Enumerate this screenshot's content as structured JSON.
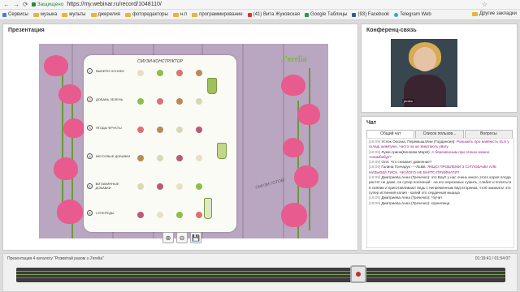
{
  "browser": {
    "back_icon": "arrow-left-icon",
    "forward_icon": "arrow-right-icon",
    "reload_icon": "reload-icon",
    "secure_label": "Защищено",
    "url": "https://my.webinar.ru/record/1048110/"
  },
  "bookmarks": {
    "items": [
      "Сервисы",
      "музыка",
      "мульты",
      "джерелия",
      "фоторедакторы",
      "н.п",
      "программирование",
      "(41) Вита Жуковская",
      "Google Таблицы",
      "(93) Facebook",
      "Telegram Web"
    ],
    "other": "Другие закладки"
  },
  "presentation": {
    "title": "Презентация",
    "brand": "J'erelia",
    "slide_title": "СМУЗИ-КОНСТРУКТОР",
    "steps": [
      "ВЫБЕРИ ОСНОВУ",
      "ДОБАВЬ ЗЕЛЕНЬ",
      "ЯГОДЫ ФРУКТЫ",
      "ВКУСОВЫЕ ДОБАВКИ",
      "ВИТАМИННЫЕ ДОБАВКИ",
      "СУПЕРЕДЫ"
    ],
    "step_nums": [
      "1",
      "2",
      "3",
      "4",
      "5",
      "6"
    ],
    "ready_text": "СМУЗИ ГОТОВ!",
    "zoom_in": "⊕",
    "zoom_out": "⊖",
    "save": "💾"
  },
  "conference": {
    "title": "Конференц-связь",
    "video_label": "jerelia"
  },
  "chat": {
    "title": "Чат",
    "tabs": [
      "Общий чат",
      "Список пользов...",
      "Вопросы"
    ],
    "messages": [
      {
        "time": "[18:09]",
        "author": "Устюк Оксана, Перемышляни (Гордансия):",
        "text": "Розкажіть про наявність SLS у складі шампуню, часто на це звертають увагу",
        "style": "pk"
      },
      {
        "time": "[18:09]",
        "author": "Лукач Ірина(Бачкова Марія):",
        "text": "А беременным при отеках можно тонимбибур?",
        "style": "pk"
      },
      {
        "time": "[18:09]",
        "author": "Оля:",
        "text": "Что снижает давление?",
        "style": "tx"
      },
      {
        "time": "[18:09]",
        "author": "Галина Гончарук ----Львів:",
        "text": "ЯКЩО ПРОБЛЕМИ З СУГЛОБАМИ АЛЕ НИЗЬКИЙ ТИСК. ЧИ ЙОГО НЕ ВАРТО ПРИЙМАТИ?",
        "style": "pk"
      },
      {
        "time": "[18:09]",
        "author": "Дмитриева Анна (Гречечко):",
        "text": "это Вау!! у нас очень много этого корня плода растет не даже, он супер полезный - на его нерезаных сушить, слабит и почиться в сиянии и приготавливают ведь с непременным вед вторника, чтоб заказать! это супер истинния калия - калий это сердечная мышца",
        "style": "tx"
      },
      {
        "time": "[18:09]",
        "author": "Дмитриева Анна (Гречечко):",
        "text": "*пучит",
        "style": "tx"
      },
      {
        "time": "[18:09]",
        "author": "Дмитриева Анна (Гречечко):",
        "text": "корнелица",
        "style": "tx"
      }
    ]
  },
  "player": {
    "title": "Презентация 4 каталогу \"Розквітай разом з J'erelia\"",
    "time": "01:19:41 / 01:54:07",
    "progress": 0.7
  },
  "colors": {
    "accent_pink": "#a0208a",
    "brand_green": "#7ab83a",
    "bookmark_folder": "#e6b53a"
  }
}
